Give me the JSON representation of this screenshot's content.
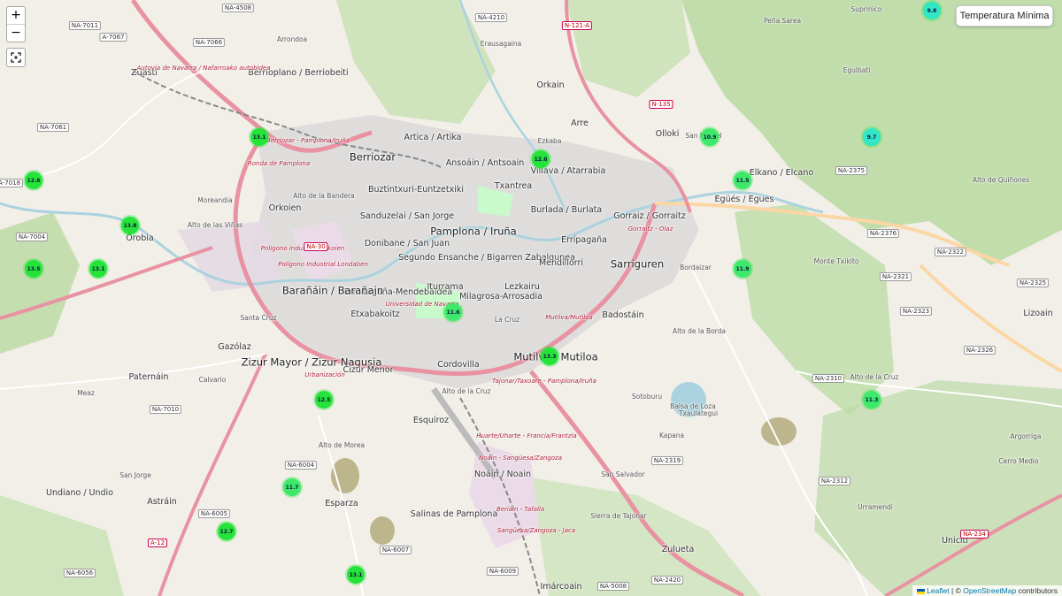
{
  "controls": {
    "zoom_in": "+",
    "zoom_out": "−",
    "layer_button": "Temperatura Mínima"
  },
  "attribution": {
    "leaflet": "Leaflet",
    "separator": " | © ",
    "osm": "OpenStreetMap",
    "suffix": " contributors"
  },
  "colors": {
    "marker_green": "#26e33a",
    "marker_cyan": "#34e6c6",
    "marker_mid": "#3ee86a"
  },
  "markers": [
    {
      "label": "9.8",
      "color": "cyan"
    },
    {
      "label": "13.1",
      "color": "green"
    },
    {
      "label": "12.6",
      "color": "green"
    },
    {
      "label": "12.6",
      "color": "green"
    },
    {
      "label": "10.9",
      "color": "mid"
    },
    {
      "label": "9.7",
      "color": "cyan"
    },
    {
      "label": "11.5",
      "color": "mid"
    },
    {
      "label": "13.8",
      "color": "green"
    },
    {
      "label": "13.5",
      "color": "green"
    },
    {
      "label": "13.1",
      "color": "green"
    },
    {
      "label": "11.9",
      "color": "mid"
    },
    {
      "label": "11.6",
      "color": "mid"
    },
    {
      "label": "13.3",
      "color": "green"
    },
    {
      "label": "12.5",
      "color": "green"
    },
    {
      "label": "11.3",
      "color": "mid"
    },
    {
      "label": "11.7",
      "color": "mid"
    },
    {
      "label": "12.7",
      "color": "green"
    },
    {
      "label": "13.1",
      "color": "green"
    }
  ],
  "places": [
    {
      "text": "Pamplona / Iruña",
      "cls": "big"
    },
    {
      "text": "Berriozar",
      "cls": "big"
    },
    {
      "text": "Ansoáin / Antsoain",
      "cls": "med"
    },
    {
      "text": "Villava / Atarrabia",
      "cls": "med"
    },
    {
      "text": "Burlada / Burlata",
      "cls": "med"
    },
    {
      "text": "Txantrea",
      "cls": "med"
    },
    {
      "text": "Segundo Ensanche / Bigarren Zabalgunea",
      "cls": "med"
    },
    {
      "text": "Ermitagaña-Mendebaldea",
      "cls": "med"
    },
    {
      "text": "Barañáin / Barañain",
      "cls": "big"
    },
    {
      "text": "Iturrama",
      "cls": "med"
    },
    {
      "text": "Milagrosa-Arrosadia",
      "cls": "med"
    },
    {
      "text": "Lezkairu",
      "cls": "med"
    },
    {
      "text": "Mendillorri",
      "cls": "med"
    },
    {
      "text": "Sarriguren",
      "cls": "big"
    },
    {
      "text": "Zizur Mayor / Zizur Nagusia",
      "cls": "big"
    },
    {
      "text": "Mutilva / Mutiloa",
      "cls": "big"
    },
    {
      "text": "Orkoien",
      "cls": "med"
    },
    {
      "text": "Sanduzelai / San Jorge",
      "cls": "med"
    },
    {
      "text": "Buztintxuri-Euntzetxiki",
      "cls": "med"
    },
    {
      "text": "Donibane / San Juan",
      "cls": "med"
    },
    {
      "text": "Etxabakoitz",
      "cls": "med"
    },
    {
      "text": "Orobia",
      "cls": "med"
    },
    {
      "text": "Gorraiz / Gorraitz",
      "cls": "med"
    },
    {
      "text": "Olloki",
      "cls": "med"
    },
    {
      "text": "Egüés / Egues",
      "cls": "med"
    },
    {
      "text": "Elkano / Elcano",
      "cls": "med"
    },
    {
      "text": "Badostáin",
      "cls": "med"
    },
    {
      "text": "Noáin / Noain",
      "cls": "med"
    },
    {
      "text": "Salinas de Pamplona",
      "cls": "med"
    },
    {
      "text": "Esparza",
      "cls": "med"
    },
    {
      "text": "Cordovilla",
      "cls": "med"
    },
    {
      "text": "Esquíroz",
      "cls": "med"
    },
    {
      "text": "Zulueta",
      "cls": "med"
    },
    {
      "text": "Imárcoain",
      "cls": "med"
    },
    {
      "text": "Uniciti",
      "cls": "med"
    },
    {
      "text": "Astráin",
      "cls": "med"
    },
    {
      "text": "Undiano / Undio",
      "cls": "med"
    },
    {
      "text": "Paternáin",
      "cls": "med"
    },
    {
      "text": "Gazólaz",
      "cls": "med"
    },
    {
      "text": "Cizur Menor",
      "cls": "med"
    },
    {
      "text": "Zuasti",
      "cls": "med"
    },
    {
      "text": "Berrioplano / Berriobeiti",
      "cls": "med"
    },
    {
      "text": "Orkain",
      "cls": "med"
    },
    {
      "text": "Arre",
      "cls": "med"
    },
    {
      "text": "Artica / Artika",
      "cls": "med"
    },
    {
      "text": "Lizoain",
      "cls": "med"
    },
    {
      "text": "Errípagaña",
      "cls": "med"
    },
    {
      "text": "La Cruz",
      "cls": "small"
    },
    {
      "text": "Alto de la Cruz",
      "cls": "small"
    },
    {
      "text": "Bordaizar",
      "cls": "small"
    },
    {
      "text": "Sotoburu",
      "cls": "small"
    },
    {
      "text": "Kapana",
      "cls": "small"
    },
    {
      "text": "San Salvador",
      "cls": "small"
    },
    {
      "text": "Sierra de Tajonar",
      "cls": "small"
    },
    {
      "text": "Balsa de Loza",
      "cls": "small"
    },
    {
      "text": "Monte Txikito",
      "cls": "small"
    },
    {
      "text": "San Miguel",
      "cls": "small"
    },
    {
      "text": "Alto de la Borda",
      "cls": "small"
    },
    {
      "text": "Txaulategui",
      "cls": "small"
    },
    {
      "text": "Calvario",
      "cls": "small"
    },
    {
      "text": "Meaz",
      "cls": "small"
    },
    {
      "text": "San Jorge",
      "cls": "small"
    },
    {
      "text": "Santa Cruz",
      "cls": "small"
    },
    {
      "text": "Arrondoa",
      "cls": "small"
    },
    {
      "text": "Alto de la Bandera",
      "cls": "small"
    },
    {
      "text": "Moreandia",
      "cls": "small"
    },
    {
      "text": "Alto de las Viñas",
      "cls": "small"
    },
    {
      "text": "Alto de Morea",
      "cls": "small"
    },
    {
      "text": "Alto de Quiñones",
      "cls": "small"
    },
    {
      "text": "Ezkaba",
      "cls": "small"
    },
    {
      "text": "Erausagaina",
      "cls": "small"
    },
    {
      "text": "Cerro Medio",
      "cls": "small"
    },
    {
      "text": "Urramendi",
      "cls": "small"
    },
    {
      "text": "Argorriga",
      "cls": "small"
    },
    {
      "text": "Peña Sarea",
      "cls": "small"
    },
    {
      "text": "Suprinico",
      "cls": "small"
    },
    {
      "text": "Egulbati",
      "cls": "small"
    },
    {
      "text": "Alto de la Cruz",
      "cls": "small"
    }
  ],
  "road_labels": [
    {
      "text": "Berriozar - Pamplona/Iruña"
    },
    {
      "text": "Ronda de Pamplona"
    },
    {
      "text": "Autovía de Navarra / Nafarroako autobidea"
    },
    {
      "text": "Tajonar/Taxoare - Pamplona/Iruña"
    },
    {
      "text": "Huarte/Uharte - Francia/Frantzia"
    },
    {
      "text": "Noain - Sangüesa/Zangoza"
    },
    {
      "text": "Sangüesa/Zangoza - Jaca"
    },
    {
      "text": "Beriain - Tafalla"
    },
    {
      "text": "Mutilva/Mutiloa"
    },
    {
      "text": "Urbanización"
    },
    {
      "text": "Universidad de Navarra"
    },
    {
      "text": "Polígono Industrial Londaben"
    },
    {
      "text": "Polígono industrial Orkoien"
    },
    {
      "text": "Gorraitz - Olaz"
    }
  ],
  "road_shields": [
    {
      "text": "NA-4508",
      "red": false
    },
    {
      "text": "NA-4210",
      "red": false
    },
    {
      "text": "N-121-A",
      "red": true
    },
    {
      "text": "NA-7011",
      "red": false
    },
    {
      "text": "A-7067",
      "red": false
    },
    {
      "text": "NA-7066",
      "red": false
    },
    {
      "text": "N-135",
      "red": true
    },
    {
      "text": "NA-2375",
      "red": false
    },
    {
      "text": "NA-7061",
      "red": false
    },
    {
      "text": "NA-7018",
      "red": false
    },
    {
      "text": "NA-7004",
      "red": false
    },
    {
      "text": "NA-30",
      "red": true
    },
    {
      "text": "NA-2376",
      "red": false
    },
    {
      "text": "NA-2322",
      "red": false
    },
    {
      "text": "NA-2321",
      "red": false
    },
    {
      "text": "NA-2325",
      "red": false
    },
    {
      "text": "NA-2323",
      "red": false
    },
    {
      "text": "NA-2326",
      "red": false
    },
    {
      "text": "NA-2310",
      "red": false
    },
    {
      "text": "NA-7010",
      "red": false
    },
    {
      "text": "NA-6004",
      "red": false
    },
    {
      "text": "NA-2319",
      "red": false
    },
    {
      "text": "NA-2312",
      "red": false
    },
    {
      "text": "NA-6005",
      "red": false
    },
    {
      "text": "A-12",
      "red": true
    },
    {
      "text": "NA-6007",
      "red": false
    },
    {
      "text": "NA-6056",
      "red": false
    },
    {
      "text": "NA-6009",
      "red": false
    },
    {
      "text": "NA-5008",
      "red": false
    },
    {
      "text": "NA-2420",
      "red": false
    },
    {
      "text": "NA-234",
      "red": true
    }
  ]
}
